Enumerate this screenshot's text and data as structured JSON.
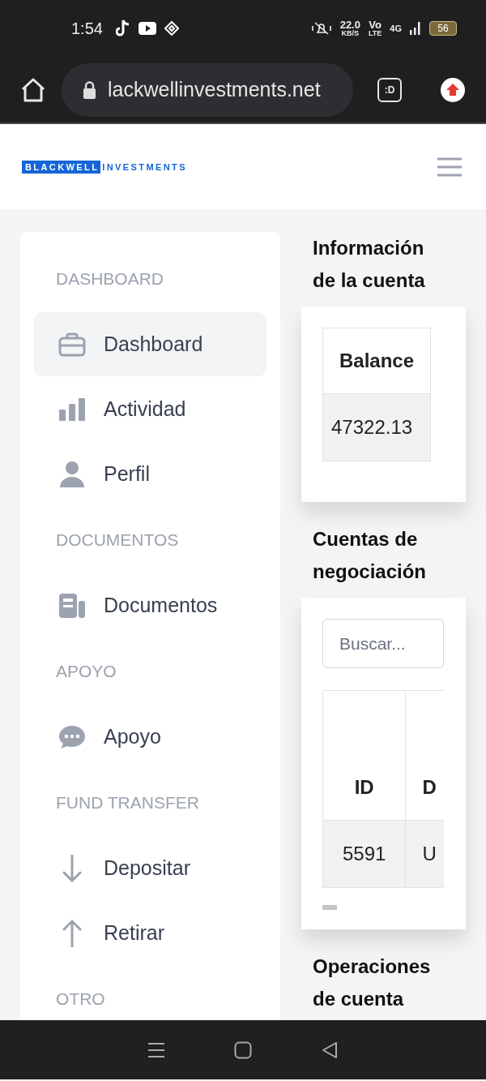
{
  "status_bar": {
    "time": "1:54",
    "net_speed": "22.0",
    "net_unit": "KB/S",
    "volte_top": "Vo",
    "volte_bottom": "LTE",
    "network": "4G",
    "battery": "56"
  },
  "browser": {
    "url": "lackwellinvestments.net",
    "tab_badge": ":D"
  },
  "header": {
    "logo_primary": "BLACKWELL",
    "logo_secondary": "INVESTMENTS"
  },
  "sidebar": {
    "items": [
      {
        "kind": "section",
        "label": "DASHBOARD"
      },
      {
        "kind": "link",
        "label": "Dashboard",
        "selected": true
      },
      {
        "kind": "link",
        "label": "Actividad",
        "selected": false
      },
      {
        "kind": "link",
        "label": "Perfil",
        "selected": false
      },
      {
        "kind": "section",
        "label": "DOCUMENTOS"
      },
      {
        "kind": "link",
        "label": "Documentos",
        "selected": false
      },
      {
        "kind": "section",
        "label": "APOYO"
      },
      {
        "kind": "link",
        "label": "Apoyo",
        "selected": false
      },
      {
        "kind": "section",
        "label": "FUND TRANSFER"
      },
      {
        "kind": "link",
        "label": "Depositar",
        "selected": false
      },
      {
        "kind": "link",
        "label": "Retirar",
        "selected": false
      },
      {
        "kind": "section",
        "label": "OTRO"
      }
    ]
  },
  "account_info": {
    "title": "Información de la cuenta",
    "table": {
      "columns": [
        "Balance"
      ],
      "rows": [
        [
          "47322.13"
        ]
      ]
    }
  },
  "trading_accounts": {
    "title": "Cuentas de negociación",
    "search": {
      "placeholder": "Buscar..."
    },
    "table": {
      "columns": [
        "ID",
        "D"
      ],
      "rows": [
        [
          "5591",
          "U"
        ]
      ]
    }
  },
  "account_operations": {
    "title": "Operaciones de cuenta"
  }
}
